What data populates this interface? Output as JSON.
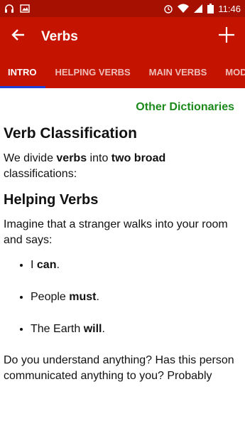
{
  "status_bar": {
    "time": "11:46",
    "left_icons": [
      "headphones-icon",
      "image-icon"
    ],
    "right_icons": [
      "alarm-icon",
      "wifi-icon",
      "signal-icon",
      "battery-icon"
    ]
  },
  "app_bar": {
    "title": "Verbs",
    "back_icon": "arrow-back-icon",
    "add_icon": "plus-icon"
  },
  "tabs": [
    {
      "label": "INTRO",
      "active": true
    },
    {
      "label": "HELPING VERBS",
      "active": false
    },
    {
      "label": "MAIN VERBS",
      "active": false
    },
    {
      "label": "MODA",
      "active": false
    }
  ],
  "content": {
    "other_link": "Other Dictionaries",
    "heading1": "Verb Classification",
    "para1": {
      "t1": "We divide ",
      "b1": "verbs",
      "t2": " into ",
      "b2": "two broad",
      "t3": " classifications:"
    },
    "heading2": "Helping Verbs",
    "para2": "Imagine that a stranger walks into your room and says:",
    "bullets": [
      {
        "pre": "I ",
        "bold": "can",
        "post": "."
      },
      {
        "pre": "People ",
        "bold": "must",
        "post": "."
      },
      {
        "pre": "The Earth ",
        "bold": "will",
        "post": "."
      }
    ],
    "para3": "Do you understand anything? Has this person communicated anything to you? Probably"
  },
  "colors": {
    "status_bar": "#a51000",
    "app_bar": "#c41400",
    "tab_indicator": "#1e3fd8",
    "link_green": "#1b8a1b"
  }
}
